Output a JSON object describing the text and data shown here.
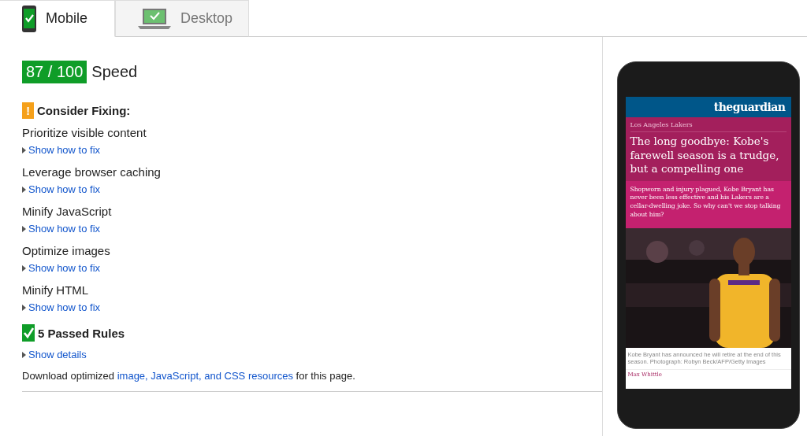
{
  "tabs": [
    {
      "label": "Mobile",
      "kind": "phone",
      "selected": true
    },
    {
      "label": "Desktop",
      "kind": "laptop",
      "selected": false
    }
  ],
  "score": {
    "value": "87 / 100",
    "label": "Speed"
  },
  "consider": {
    "title": "Consider Fixing:",
    "icon": "!"
  },
  "rules": [
    {
      "name": "Prioritize visible content",
      "link": "Show how to fix"
    },
    {
      "name": "Leverage browser caching",
      "link": "Show how to fix"
    },
    {
      "name": "Minify JavaScript",
      "link": "Show how to fix"
    },
    {
      "name": "Optimize images",
      "link": "Show how to fix"
    },
    {
      "name": "Minify HTML",
      "link": "Show how to fix"
    }
  ],
  "passed": {
    "title": "5 Passed Rules",
    "link": "Show details"
  },
  "download": {
    "before": "Download optimized ",
    "link": "image, JavaScript, and CSS resources",
    "after": " for this page."
  },
  "preview": {
    "logo": "theguardian",
    "section": "Los Angeles Lakers",
    "headline": "The long goodbye: Kobe's farewell season is a trudge, but a compelling one",
    "standfirst": "Shopworn and injury plagued, Kobe Bryant has never been less effective and his Lakers are a cellar-dwelling joke. So why can't we stop talking about him?",
    "caption": "Kobe Bryant has announced he will retire at the end of this season. Photograph: Robyn Beck/AFP/Getty Images",
    "byline": "Max Whittle"
  }
}
